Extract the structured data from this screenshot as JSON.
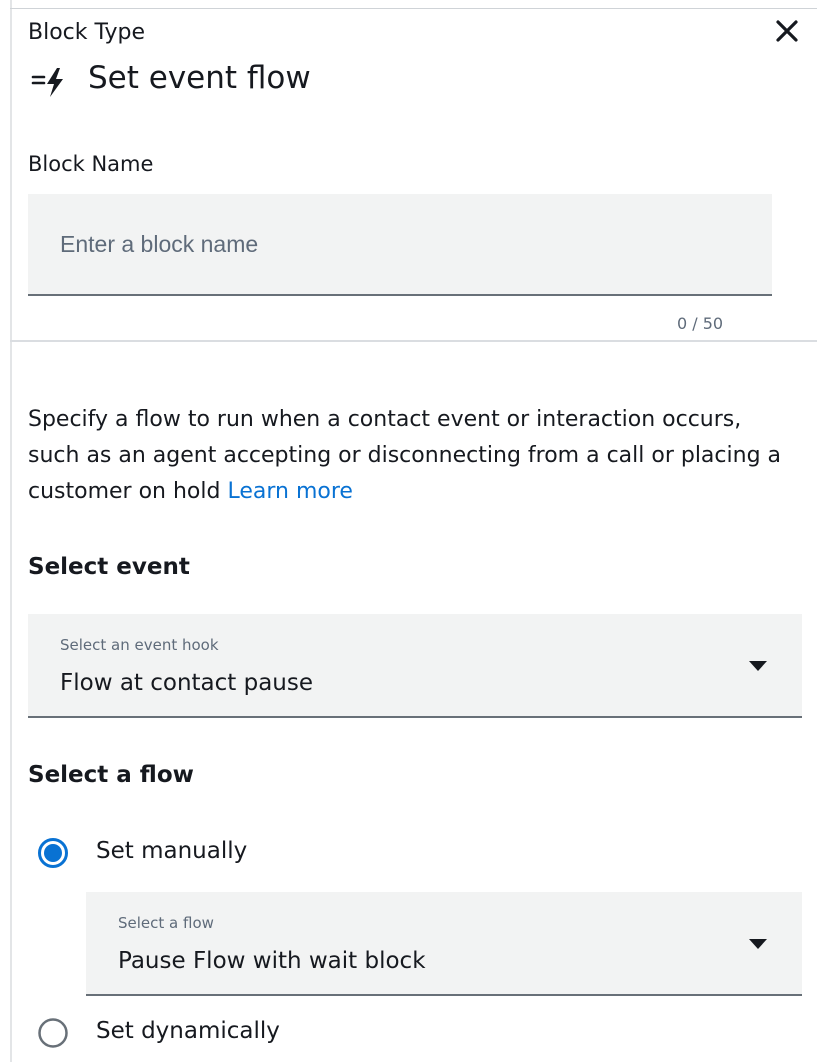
{
  "header": {
    "block_type_label": "Block Type",
    "title": "Set event flow",
    "title_icon": "event-flow-icon",
    "close_icon": "close-icon"
  },
  "block_name": {
    "label": "Block Name",
    "placeholder": "Enter a block name",
    "value": "",
    "char_count": "0 / 50"
  },
  "description": {
    "text": "Specify a flow to run when a contact event or interaction occurs, such as an agent accepting or disconnecting from a call or placing a customer on hold",
    "link_label": "Learn more"
  },
  "select_event": {
    "heading": "Select event",
    "caption": "Select an event hook",
    "value": "Flow at contact pause"
  },
  "select_flow": {
    "heading": "Select a flow",
    "options": [
      {
        "label": "Set manually",
        "selected": true
      },
      {
        "label": "Set dynamically",
        "selected": false
      }
    ],
    "flow_dropdown": {
      "caption": "Select a flow",
      "value": "Pause Flow with wait block"
    }
  },
  "colors": {
    "link": "#0972d3",
    "radio_selected": "#0972d3",
    "field_bg": "#f2f3f3",
    "border": "#687078"
  }
}
